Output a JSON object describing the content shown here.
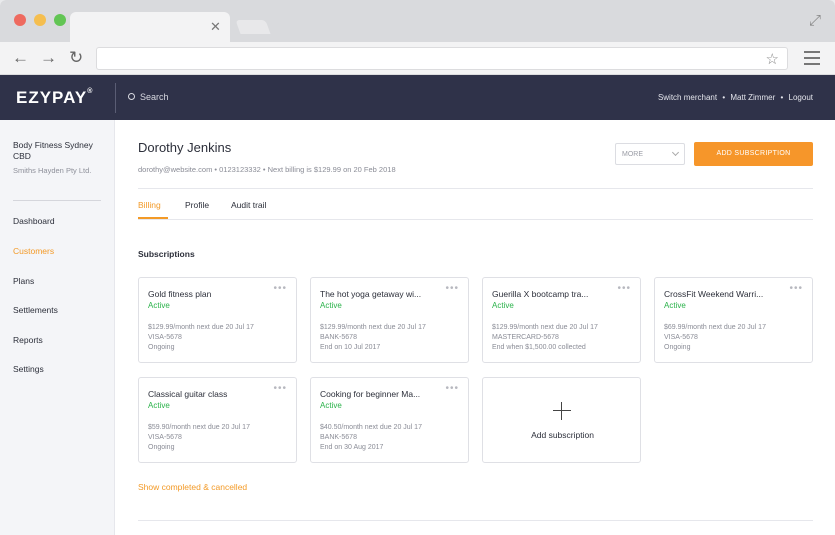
{
  "browser": {
    "icons": {
      "close": "close-icon",
      "back": "back-arrow-icon",
      "forward": "forward-arrow-icon",
      "reload": "reload-icon",
      "bookmark": "star-icon",
      "menu": "hamburger-menu-icon",
      "expand": "expand-icon"
    },
    "traffic_colors": [
      "#ee6a5f",
      "#f5be4f",
      "#62c554"
    ]
  },
  "header": {
    "logo": "EZYPAY",
    "logo_mark": "®",
    "search_label": "Search",
    "links": [
      "Switch merchant",
      "Matt Zimmer",
      "Logout"
    ],
    "separator": "•",
    "background": "#2f3249"
  },
  "sidebar": {
    "merchant_name": "Body Fitness Sydney CBD",
    "merchant_company": "Smiths Hayden Pty Ltd.",
    "items": [
      {
        "label": "Dashboard",
        "active": false
      },
      {
        "label": "Customers",
        "active": true
      },
      {
        "label": "Plans",
        "active": false
      },
      {
        "label": "Settlements",
        "active": false
      },
      {
        "label": "Reports",
        "active": false
      },
      {
        "label": "Settings",
        "active": false
      }
    ]
  },
  "customer": {
    "name": "Dorothy Jenkins",
    "meta": "dorothy@website.com  •  0123123332  •  Next billing is $129.99 on 20 Feb 2018",
    "more_label": "MORE",
    "add_subscription_label": "ADD SUBSCRIPTION"
  },
  "tabs": [
    {
      "label": "Billing",
      "active": true
    },
    {
      "label": "Profile",
      "active": false
    },
    {
      "label": "Audit trail",
      "active": false
    }
  ],
  "subscriptions": {
    "title": "Subscriptions",
    "cards": [
      {
        "title": "Gold fitness plan",
        "status": "Active",
        "lines": [
          "$129.99/month next due 20 Jul 17",
          "VISA-5678",
          "Ongoing"
        ]
      },
      {
        "title": "The hot yoga getaway wi...",
        "status": "Active",
        "lines": [
          "$129.99/month next due 20 Jul 17",
          "BANK-5678",
          "End on 10 Jul 2017"
        ]
      },
      {
        "title": "Guerilla X bootcamp tra...",
        "status": "Active",
        "lines": [
          "$129.99/month next due 20 Jul 17",
          "MASTERCARD-5678",
          "End when $1,500.00 collected"
        ]
      },
      {
        "title": "CrossFit Weekend Warri...",
        "status": "Active",
        "lines": [
          "$69.99/month next due 20 Jul 17",
          "VISA-5678",
          "Ongoing"
        ]
      },
      {
        "title": "Classical guitar class",
        "status": "Active",
        "lines": [
          "$59.90/month next due 20 Jul 17",
          "VISA-5678",
          "Ongoing"
        ]
      },
      {
        "title": "Cooking for beginner Ma...",
        "status": "Active",
        "lines": [
          "$40.50/month next due 20 Jul 17",
          "BANK-5678",
          "End on 30 Aug 2017"
        ]
      }
    ],
    "add_label": "Add subscription",
    "dots": "•••",
    "show_link": "Show completed & cancelled"
  },
  "colors": {
    "accent": "#f39a27",
    "button": "#f6962a",
    "active_status": "#2ab24a"
  }
}
